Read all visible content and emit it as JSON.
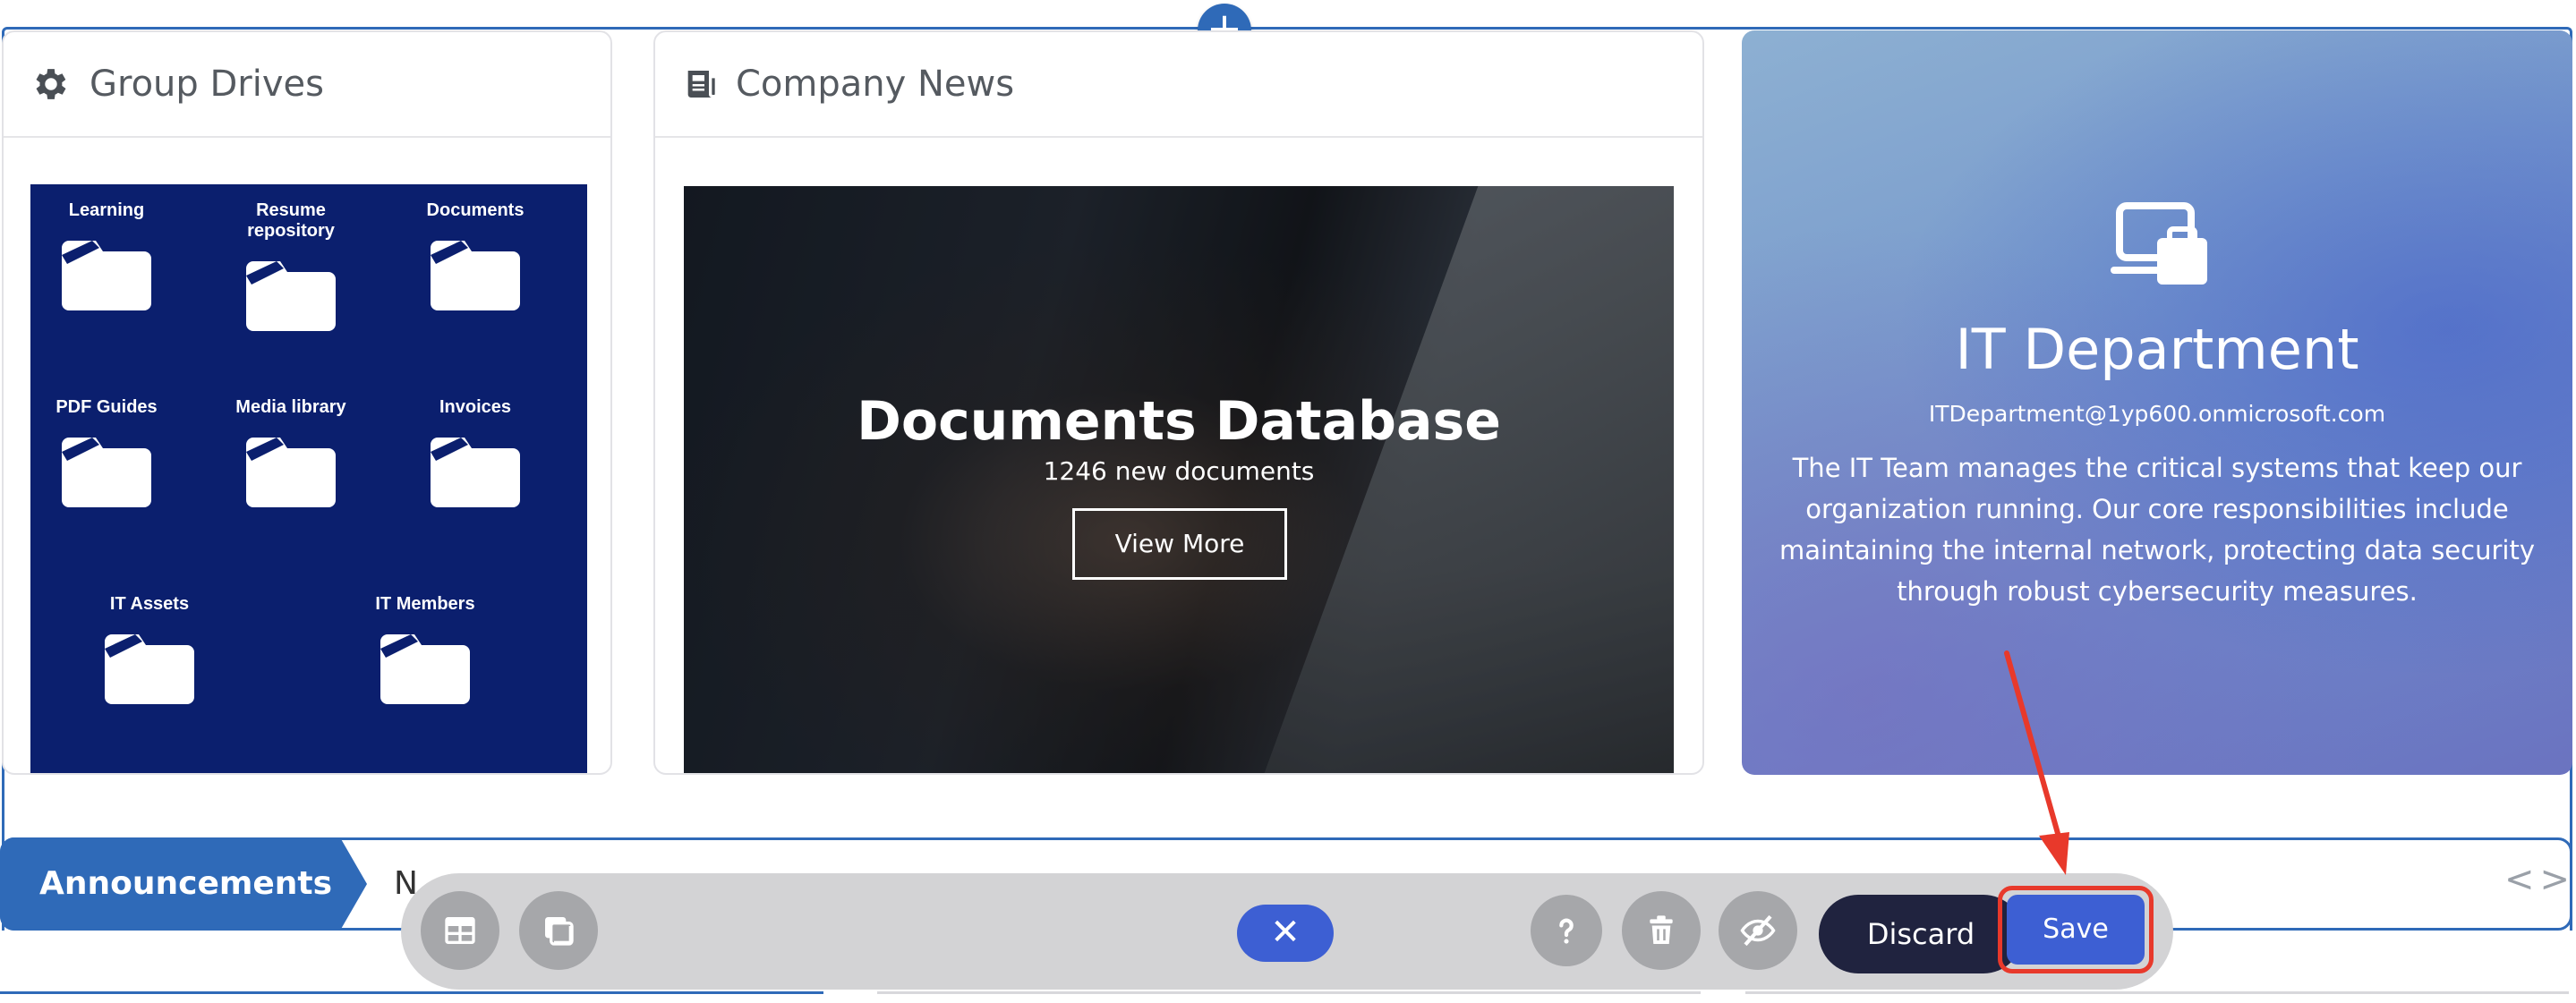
{
  "group_drives": {
    "title": "Group Drives",
    "icon": "gear-icon",
    "folders": [
      {
        "label": "Learning"
      },
      {
        "label": "Resume repository"
      },
      {
        "label": "Documents"
      },
      {
        "label": "PDF Guides"
      },
      {
        "label": "Media library"
      },
      {
        "label": "Invoices"
      },
      {
        "label": "IT Assets"
      },
      {
        "label": "IT Members"
      }
    ]
  },
  "company_news": {
    "title": "Company News",
    "icon": "newspaper-icon",
    "headline": "Documents Database",
    "subtitle": "1246 new documents",
    "button": "View More"
  },
  "it_department": {
    "icon": "laptop-briefcase-icon",
    "title": "IT Department",
    "email": "ITDepartment@1yp600.onmicrosoft.com",
    "description": "The IT Team manages the critical systems that keep our organization running. Our core responsibilities include maintaining the internal network, protecting data security through robust cybersecurity measures."
  },
  "announcements": {
    "label": "Announcements",
    "text": "N",
    "nav": "<>"
  },
  "add_section": {
    "symbol": "+"
  },
  "toolbar": {
    "close_symbol": "✕",
    "discard": "Discard",
    "save": "Save",
    "icons": [
      "layout-icon",
      "copy-icon",
      "help-icon",
      "delete-icon",
      "hide-icon"
    ]
  },
  "colors": {
    "accent": "#2f6ab8",
    "drives_bg": "#0b1f6e",
    "save": "#3d5fd3",
    "discard": "#20233f",
    "highlight": "#e8392b"
  }
}
